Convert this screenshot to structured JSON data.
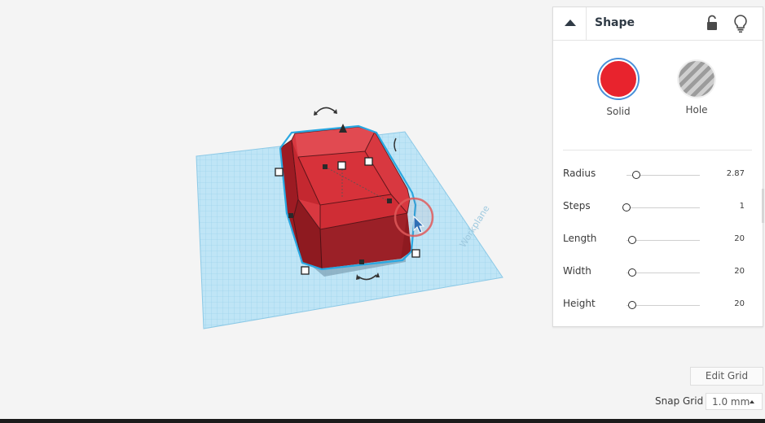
{
  "inspector": {
    "title": "Shape",
    "modes": {
      "solid": "Solid",
      "hole": "Hole"
    },
    "properties": [
      {
        "label": "Radius",
        "value": "2.87",
        "fraction": 0.13
      },
      {
        "label": "Steps",
        "value": "1",
        "fraction": 0.0
      },
      {
        "label": "Length",
        "value": "20",
        "fraction": 0.08
      },
      {
        "label": "Width",
        "value": "20",
        "fraction": 0.08
      },
      {
        "label": "Height",
        "value": "20",
        "fraction": 0.08
      }
    ]
  },
  "grid": {
    "edit_label": "Edit Grid",
    "snap_label": "Snap Grid",
    "snap_value": "1.0 mm",
    "plate_label": "Workplane"
  },
  "colors": {
    "solid": "#e8232d",
    "workplane": "#b9e2f5",
    "selection": "#2aa8e0"
  }
}
